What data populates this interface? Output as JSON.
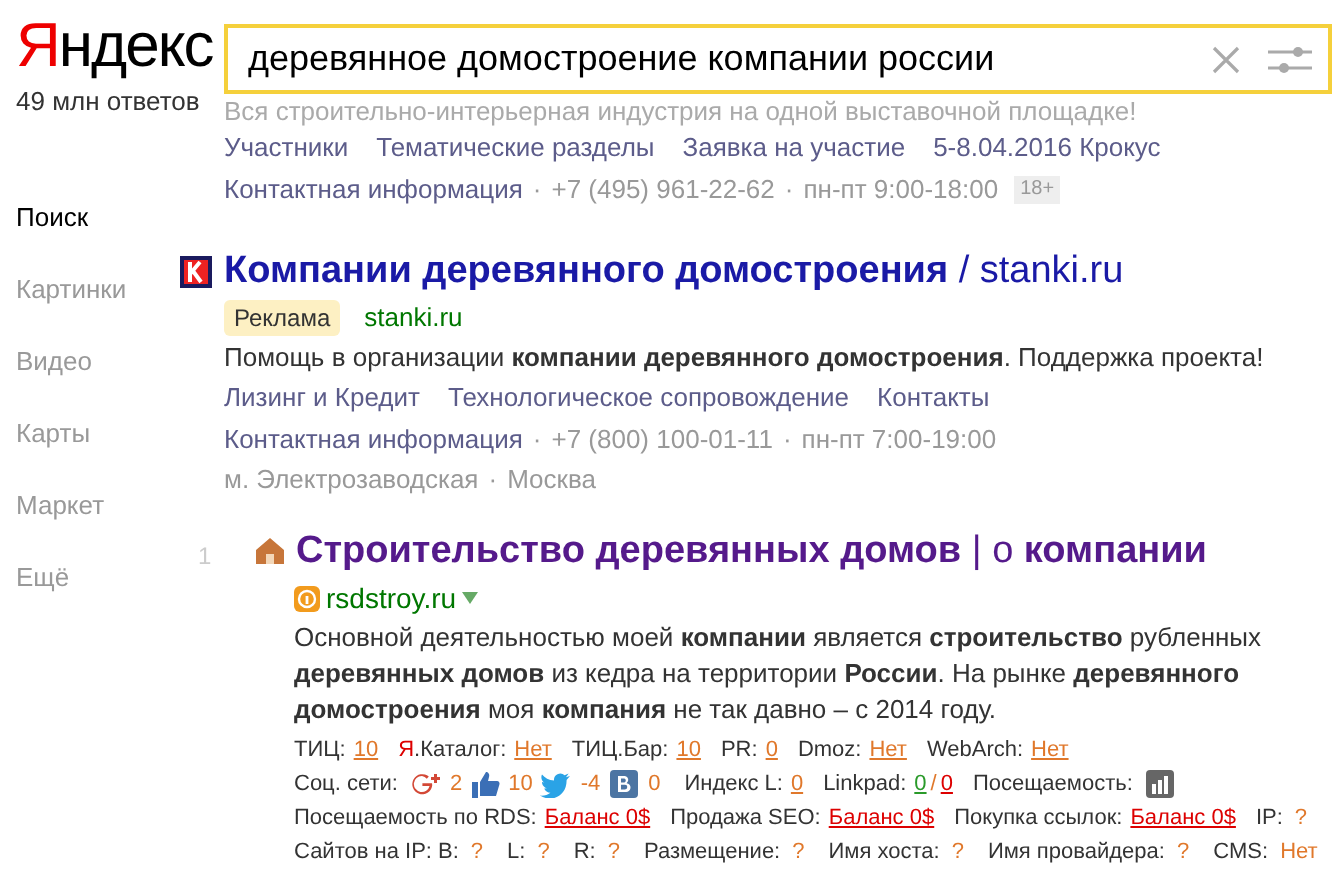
{
  "logo": {
    "text": "Яндекс",
    "count": "49 млн ответов"
  },
  "search": {
    "value": "деревянное домостроение компании россии"
  },
  "sidebar": {
    "items": [
      {
        "label": "Поиск",
        "selected": true
      },
      {
        "label": "Картинки",
        "selected": false
      },
      {
        "label": "Видео",
        "selected": false
      },
      {
        "label": "Карты",
        "selected": false
      },
      {
        "label": "Маркет",
        "selected": false
      },
      {
        "label": "Ещё",
        "selected": false
      }
    ]
  },
  "top_ad": {
    "text": "Вся строительно-интерьерная индустрия на одной выставочной площадке!",
    "links": [
      "Участники",
      "Тематические разделы",
      "Заявка на участие",
      "5-8.04.2016 Крокус"
    ],
    "contacts": [
      "Контактная информация",
      "+7 (495) 961-22-62",
      "пн-пт 9:00-18:00"
    ],
    "sep": "·",
    "age": "18+"
  },
  "ad": {
    "title": "**Компании деревянного домостроения** / stanki.ru",
    "label": "Реклама",
    "domain": "stanki.ru",
    "text": "Помощь в организации **компании деревянного домостроения**. Поддержка проекта!",
    "links": [
      "Лизинг и Кредит",
      "Технологическое сопровождение",
      "Контакты"
    ],
    "contacts": [
      "Контактная информация",
      "+7 (800) 100-01-11",
      "пн-пт 7:00-19:00"
    ],
    "address": [
      "м. Электрозаводская",
      "Москва"
    ],
    "sep": "·"
  },
  "result": {
    "number": "1",
    "title": "**Строительство деревянных домов** | о **компании**",
    "domain": "rsdstroy.ru",
    "text": "Основной деятельностью моей **компании** является **строительство** рубленных **деревянных домов** из кедра на территории **России**. На рынке **деревянного домостроения** моя **компания** не так давно – с 2014 году.",
    "seo_rows": [
      [
        {
          "kind": "label",
          "text": "ТИЦ:"
        },
        {
          "kind": "link",
          "text": "10"
        },
        {
          "kind": "red",
          "text": "Я"
        },
        {
          "kind": "label",
          "text": ".Каталог:"
        },
        {
          "kind": "link",
          "text": "Нет"
        },
        {
          "kind": "label",
          "text": "ТИЦ.Бар:"
        },
        {
          "kind": "link",
          "text": "10"
        },
        {
          "kind": "label",
          "text": "PR:"
        },
        {
          "kind": "link",
          "text": "0"
        },
        {
          "kind": "label",
          "text": "Dmoz:"
        },
        {
          "kind": "link",
          "text": "Нет"
        },
        {
          "kind": "label",
          "text": "WebArch:"
        },
        {
          "kind": "link",
          "text": "Нет"
        }
      ],
      [
        {
          "kind": "label",
          "text": "Соц. сети:"
        },
        {
          "kind": "gplus"
        },
        {
          "kind": "value",
          "text": "2"
        },
        {
          "kind": "like"
        },
        {
          "kind": "value",
          "text": "10"
        },
        {
          "kind": "twitter"
        },
        {
          "kind": "value",
          "text": "-4"
        },
        {
          "kind": "vk"
        },
        {
          "kind": "value",
          "text": "0"
        },
        {
          "kind": "label",
          "text": "Индекс L:"
        },
        {
          "kind": "link",
          "text": "0"
        },
        {
          "kind": "label",
          "text": "Linkpad:"
        },
        {
          "kind": "green",
          "text": "0"
        },
        {
          "kind": "value",
          "text": "/"
        },
        {
          "kind": "redlink",
          "text": "0"
        },
        {
          "kind": "label",
          "text": "Посещаемость:"
        },
        {
          "kind": "chart"
        }
      ],
      [
        {
          "kind": "label",
          "text": "Посещаемость по RDS:"
        },
        {
          "kind": "redlink",
          "text": "Баланс 0$"
        },
        {
          "kind": "label",
          "text": "Продажа SEO:"
        },
        {
          "kind": "redlink",
          "text": "Баланс 0$"
        },
        {
          "kind": "label",
          "text": "Покупка ссылок:"
        },
        {
          "kind": "redlink",
          "text": "Баланс 0$"
        },
        {
          "kind": "label",
          "text": "IP:"
        },
        {
          "kind": "value",
          "text": "?"
        }
      ],
      [
        {
          "kind": "label",
          "text": "Сайтов на IP: B:"
        },
        {
          "kind": "value",
          "text": "?"
        },
        {
          "kind": "label",
          "text": "L:"
        },
        {
          "kind": "value",
          "text": "?"
        },
        {
          "kind": "label",
          "text": "R:"
        },
        {
          "kind": "value",
          "text": "?"
        },
        {
          "kind": "label",
          "text": "Размещение:"
        },
        {
          "kind": "value",
          "text": "?"
        },
        {
          "kind": "label",
          "text": "Имя хоста:"
        },
        {
          "kind": "value",
          "text": "?"
        },
        {
          "kind": "label",
          "text": "Имя провайдера:"
        },
        {
          "kind": "value",
          "text": "?"
        },
        {
          "kind": "label",
          "text": "CMS:"
        },
        {
          "kind": "value",
          "text": "Нет"
        }
      ]
    ]
  }
}
